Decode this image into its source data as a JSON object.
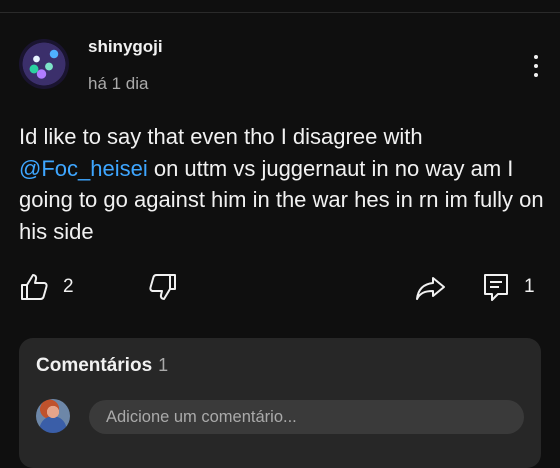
{
  "post": {
    "author": "shinygoji",
    "timestamp": "há 1 dia",
    "body_before": "Id like to say that even tho I disagree with ",
    "mention": "@Foc_heisei",
    "body_after": "  on uttm vs juggernaut in no way am I going to go against him in the war hes in rn im fully on his side"
  },
  "actions": {
    "like_count": "2",
    "comment_count": "1"
  },
  "comments": {
    "title": "Comentários",
    "count": "1",
    "input_placeholder": "Adicione um comentário..."
  },
  "icons": {
    "like": "thumbs-up-icon",
    "dislike": "thumbs-down-icon",
    "share": "share-icon",
    "comment": "comment-icon",
    "more": "more-vertical-icon"
  },
  "colors": {
    "background": "#0f0f0f",
    "text": "#f1f1f1",
    "secondary_text": "#aaaaaa",
    "mention": "#3ea6ff",
    "panel": "#272727"
  }
}
